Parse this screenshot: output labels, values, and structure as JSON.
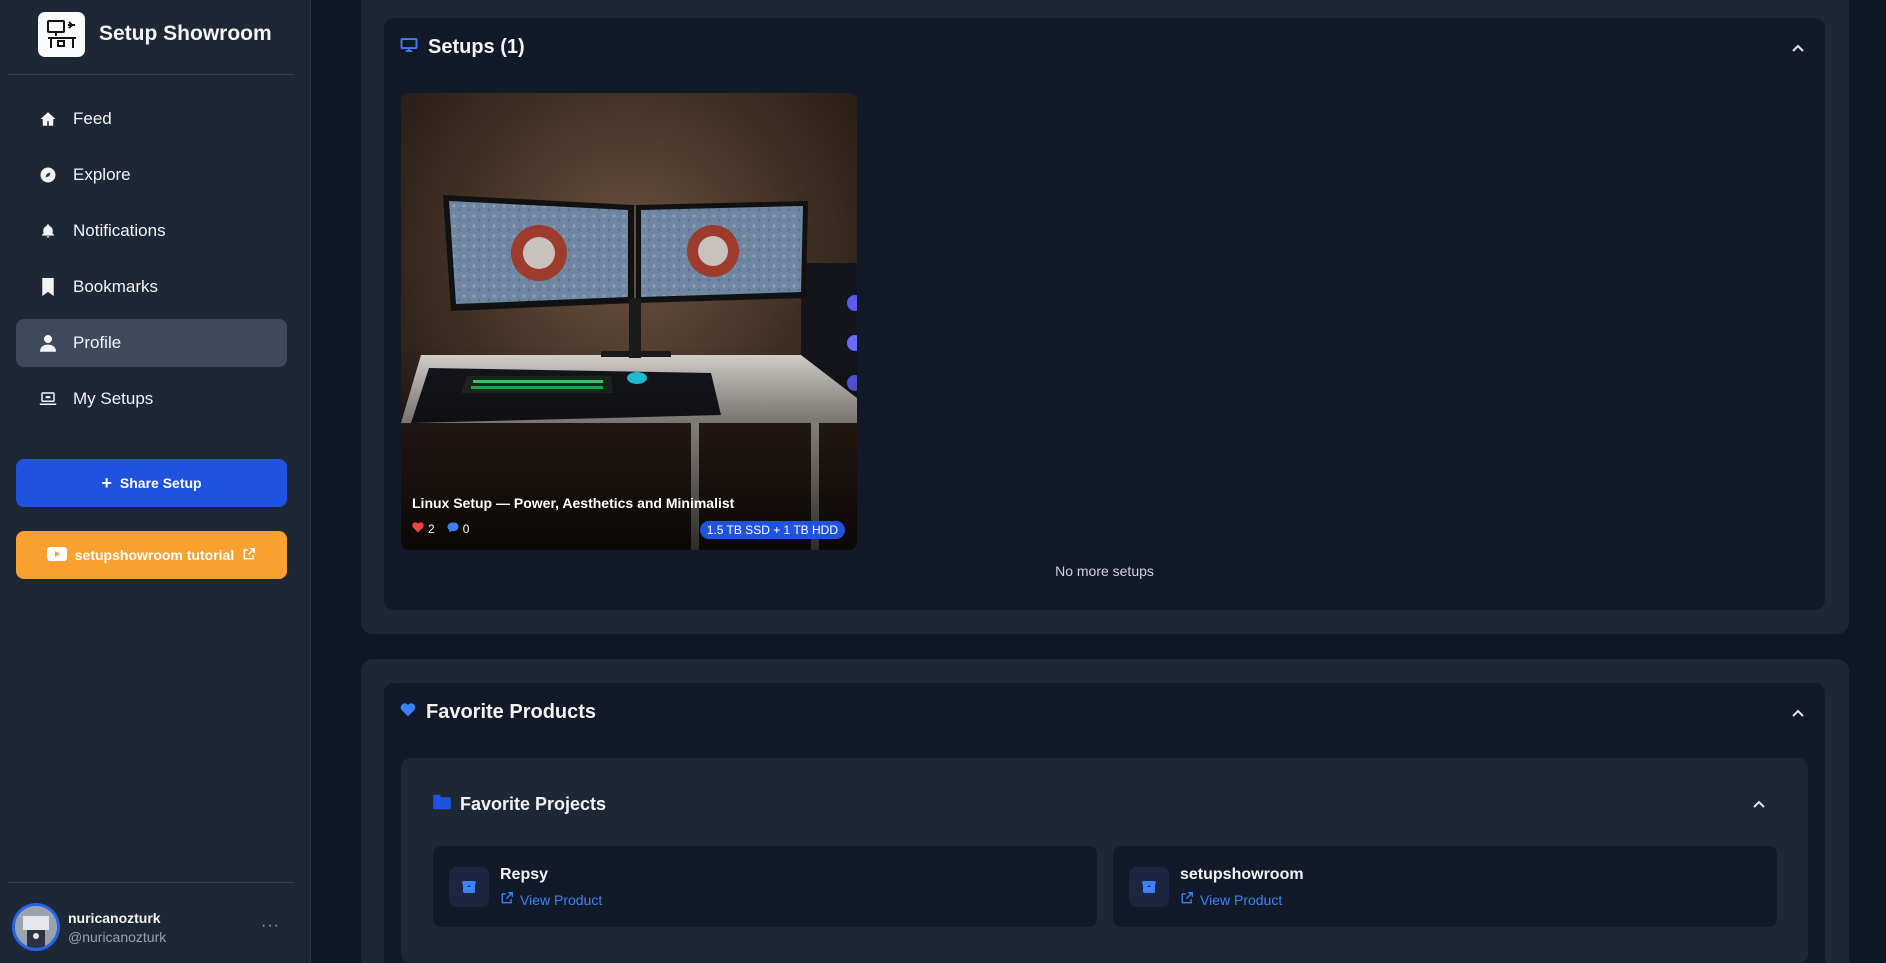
{
  "brand": {
    "title": "Setup Showroom"
  },
  "nav": {
    "items": [
      {
        "label": "Feed",
        "icon": "home-icon",
        "active": false
      },
      {
        "label": "Explore",
        "icon": "compass-icon",
        "active": false
      },
      {
        "label": "Notifications",
        "icon": "bell-icon",
        "active": false
      },
      {
        "label": "Bookmarks",
        "icon": "bookmark-icon",
        "active": false
      },
      {
        "label": "Profile",
        "icon": "user-icon",
        "active": true
      },
      {
        "label": "My Setups",
        "icon": "laptop-icon",
        "active": false
      }
    ]
  },
  "actions": {
    "share_label": "Share Setup",
    "tutorial_label": "setupshowroom tutorial"
  },
  "user": {
    "name": "nuricanozturk",
    "handle": "@nuricanozturk",
    "more": "···"
  },
  "setups": {
    "title": "Setups (1)",
    "items": [
      {
        "title": "Linux Setup — Power, Aesthetics and Minimalist",
        "likes": "2",
        "comments": "0",
        "badge": "1.5 TB SSD + 1 TB HDD"
      }
    ],
    "end_text": "No more setups"
  },
  "favorites": {
    "title": "Favorite Products",
    "projects": {
      "title": "Favorite Projects",
      "items": [
        {
          "name": "Repsy",
          "link": "View Product"
        },
        {
          "name": "setupshowroom",
          "link": "View Product"
        }
      ]
    }
  },
  "colors": {
    "accent": "#1f53df",
    "tutorial": "#f8a12f",
    "background": "#101827",
    "sidebar": "#1d2735"
  }
}
